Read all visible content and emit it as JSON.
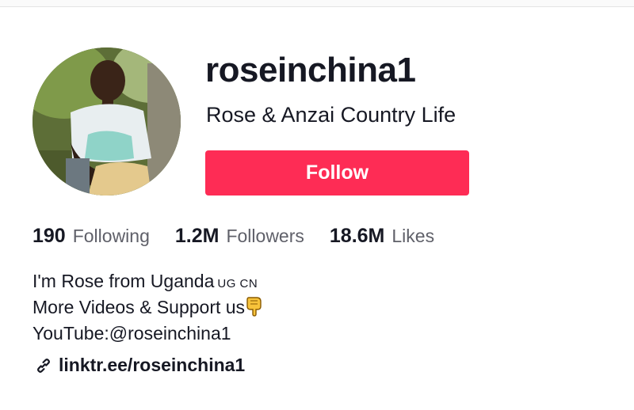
{
  "profile": {
    "username": "roseinchina1",
    "nickname": "Rose & Anzai Country Life",
    "follow_label": "Follow",
    "avatar_icon": "profile-photo"
  },
  "stats": {
    "following": {
      "value": "190",
      "label": "Following"
    },
    "followers": {
      "value": "1.2M",
      "label": "Followers"
    },
    "likes": {
      "value": "18.6M",
      "label": "Likes"
    }
  },
  "bio": {
    "line1": "I'm Rose from Uganda",
    "line1_flags": "UG CN",
    "line2": "More Videos & Support us",
    "line2_emoji": "pointing-down-emoji",
    "line3": "YouTube:@roseinchina1"
  },
  "link": {
    "icon": "link-icon",
    "text": "linktr.ee/roseinchina1"
  },
  "colors": {
    "accent": "#fe2c55",
    "text": "#161823",
    "muted": "#5f6069"
  }
}
